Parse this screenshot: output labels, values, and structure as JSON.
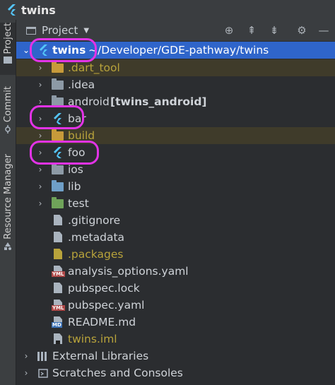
{
  "window": {
    "title": "twins"
  },
  "sidebar": {
    "tabs": [
      {
        "label": "Project"
      },
      {
        "label": "Commit"
      },
      {
        "label": "Resource Manager"
      }
    ]
  },
  "panel": {
    "title": "Project",
    "toolbar_icons": [
      "locate-icon",
      "expand-all-icon",
      "collapse-all-icon",
      "gear-icon",
      "minimize-icon"
    ]
  },
  "tree": {
    "root": {
      "name": "twins",
      "path": "~/Developer/GDE-pathway/twins"
    },
    "items": [
      {
        "label": ".dart_tool"
      },
      {
        "label": ".idea"
      },
      {
        "label": "android",
        "module": "[twins_android]"
      },
      {
        "label": "bar"
      },
      {
        "label": "build"
      },
      {
        "label": "foo"
      },
      {
        "label": "ios"
      },
      {
        "label": "lib"
      },
      {
        "label": "test"
      },
      {
        "label": ".gitignore"
      },
      {
        "label": ".metadata"
      },
      {
        "label": ".packages"
      },
      {
        "label": "analysis_options.yaml"
      },
      {
        "label": "pubspec.lock"
      },
      {
        "label": "pubspec.yaml"
      },
      {
        "label": "README.md"
      },
      {
        "label": "twins.iml"
      }
    ],
    "external": {
      "label": "External Libraries"
    },
    "scratches": {
      "label": "Scratches and Consoles"
    }
  },
  "badges": {
    "yaml": "YML",
    "md": "MD"
  },
  "colors": {
    "selection": "#2f65ca",
    "highlight": "#e233e6",
    "excluded_text": "#b8a33b",
    "flutter": "#54c5f8"
  }
}
